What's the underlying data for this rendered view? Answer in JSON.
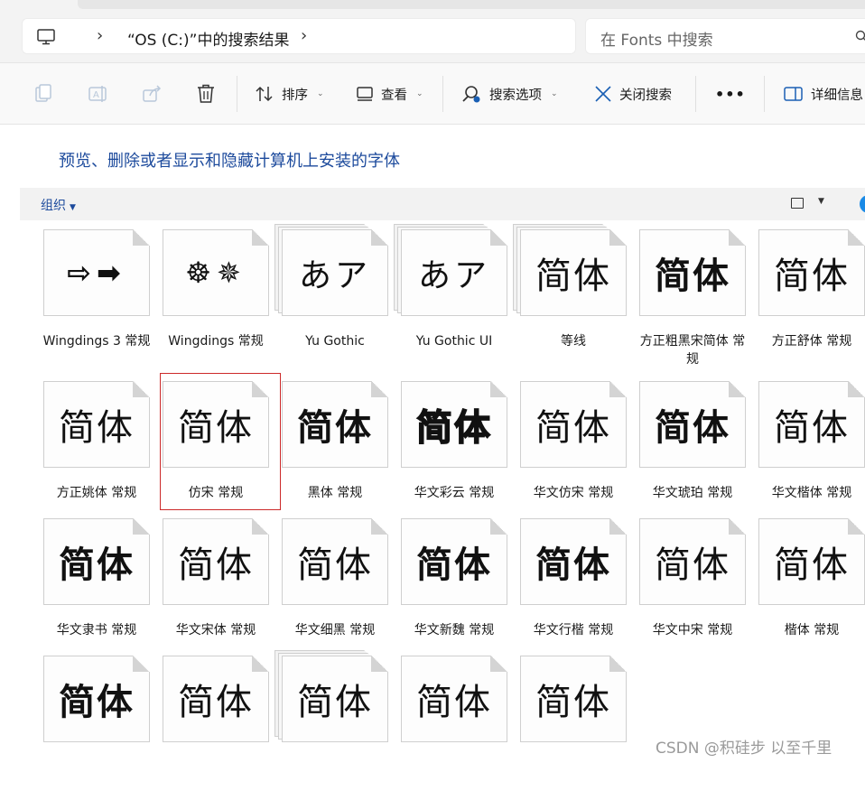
{
  "address": {
    "path": "“OS (C:)”中的搜索结果",
    "search_placeholder": "在 Fonts 中搜索"
  },
  "toolbar": {
    "sort_label": "排序",
    "view_label": "查看",
    "search_options_label": "搜索选项",
    "close_search_label": "关闭搜索",
    "more_label": "•••",
    "details_label": "详细信息"
  },
  "content": {
    "description_link": "预览、删除或者显示和隐藏计算机上安装的字体",
    "organize_label": "组织"
  },
  "fonts": [
    {
      "name": "Wingdings 3 常规",
      "sample": "⇨➡"
    },
    {
      "name": "Wingdings 常规",
      "sample": "☸✵"
    },
    {
      "name": "Yu Gothic",
      "sample": "あア"
    },
    {
      "name": "Yu Gothic UI",
      "sample": "あア"
    },
    {
      "name": "等线",
      "sample": "简体"
    },
    {
      "name": "方正粗黑宋简体 常规",
      "sample": "简体"
    },
    {
      "name": "方正舒体 常规",
      "sample": "简体"
    },
    {
      "name": "方正姚体 常规",
      "sample": "简体"
    },
    {
      "name": "仿宋 常规",
      "sample": "简体"
    },
    {
      "name": "黑体 常规",
      "sample": "简体"
    },
    {
      "name": "华文彩云 常规",
      "sample": "简体"
    },
    {
      "name": "华文仿宋 常规",
      "sample": "简体"
    },
    {
      "name": "华文琥珀 常规",
      "sample": "简体"
    },
    {
      "name": "华文楷体 常规",
      "sample": "简体"
    },
    {
      "name": "华文隶书 常规",
      "sample": "简体"
    },
    {
      "name": "华文宋体 常规",
      "sample": "简体"
    },
    {
      "name": "华文细黑 常规",
      "sample": "简体"
    },
    {
      "name": "华文新魏 常规",
      "sample": "简体"
    },
    {
      "name": "华文行楷 常规",
      "sample": "简体"
    },
    {
      "name": "华文中宋 常规",
      "sample": "简体"
    },
    {
      "name": "楷体 常规",
      "sample": "简体"
    },
    {
      "sample": "简体"
    },
    {
      "sample": "简体"
    },
    {
      "sample": "简体"
    },
    {
      "sample": "简体"
    },
    {
      "sample": "简体"
    }
  ],
  "selected_font": "仿宋 常规",
  "watermark": "CSDN @积硅步 以至千里",
  "colors": {
    "link": "#1c4a9c",
    "selection_border": "#cc2a2a",
    "help_icon": "#1a8ae6"
  }
}
